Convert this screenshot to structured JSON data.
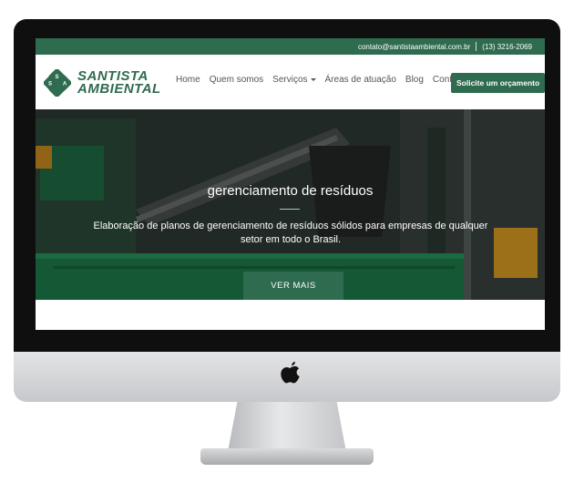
{
  "topbar": {
    "email": "contato@santistaambiental.com.br",
    "phone": "(13) 3216-2069"
  },
  "logo": {
    "line1": "SANTISTA",
    "line2": "AMBIENTAL",
    "mark_letters": [
      "S",
      "S",
      "A"
    ]
  },
  "nav": {
    "items": [
      {
        "label": "Home"
      },
      {
        "label": "Quem somos"
      },
      {
        "label": "Serviços"
      },
      {
        "label": "Áreas de atuação"
      },
      {
        "label": "Blog"
      },
      {
        "label": "Contato"
      }
    ],
    "cta_label": "Solicite um orçamento"
  },
  "hero": {
    "title": "gerenciamento de resíduos",
    "description": "Elaboração de planos de gerenciamento de resíduos sólidos para empresas de qualquer setor em todo o Brasil.",
    "button_label": "VER MAIS"
  },
  "colors": {
    "brand_green": "#2f6b4f",
    "hero_dark": "#2d3733"
  },
  "icons": {
    "device_logo": "apple-logo-icon",
    "dropdown": "chevron-down-icon"
  }
}
